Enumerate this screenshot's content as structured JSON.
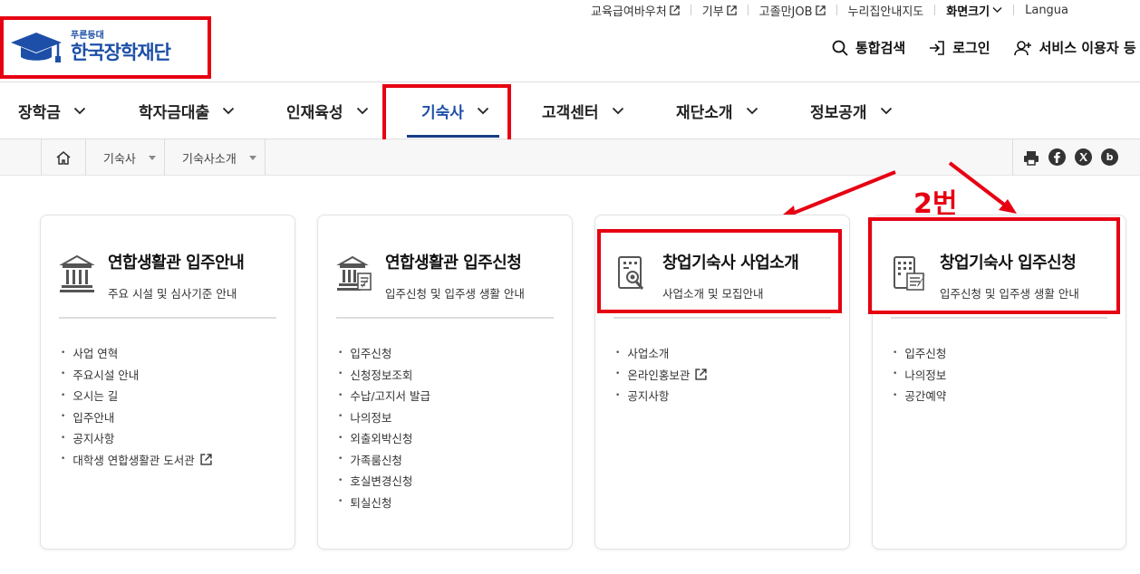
{
  "util_links": [
    {
      "label": "교육급여바우처",
      "external": true
    },
    {
      "label": "기부",
      "external": true
    },
    {
      "label": "고졸만JOB",
      "external": true
    },
    {
      "label": "누리집안내지도",
      "external": false
    },
    {
      "label": "화면크기",
      "dropdown": true
    },
    {
      "label": "Langua"
    }
  ],
  "logo": {
    "small": "푸른등대",
    "main": "한국장학재단"
  },
  "actions": {
    "search": "통합검색",
    "login": "로그인",
    "register": "서비스 이용자 등"
  },
  "nav": [
    {
      "label": "장학금"
    },
    {
      "label": "학자금대출"
    },
    {
      "label": "인재육성"
    },
    {
      "label": "기숙사"
    },
    {
      "label": "고객센터"
    },
    {
      "label": "재단소개"
    },
    {
      "label": "정보공개"
    }
  ],
  "breadcrumb": [
    "기숙사",
    "기숙사소개"
  ],
  "share": [
    "b"
  ],
  "annotation": "2번",
  "cards": [
    {
      "title": "연합생활관 입주안내",
      "subtitle": "주요 시설 및 심사기준 안내",
      "icon": "building-icon",
      "items": [
        "사업 연혁",
        "주요시설 안내",
        "오시는 길",
        "입주안내",
        "공지사항",
        "대학생 연합생활관 도서관"
      ],
      "external_last": true
    },
    {
      "title": "연합생활관 입주신청",
      "subtitle": "입주신청 및 입주생 생활 안내",
      "icon": "building-pen-icon",
      "items": [
        "입주신청",
        "신청정보조회",
        "수납/고지서 발급",
        "나의정보",
        "외출외박신청",
        "가족룸신청",
        "호실변경신청",
        "퇴실신청"
      ]
    },
    {
      "title": "창업기숙사 사업소개",
      "subtitle": "사업소개 및 모집안내",
      "icon": "document-magnifier-icon",
      "items": [
        "사업소개",
        "온라인홍보관",
        "공지사항"
      ],
      "external_index": 1
    },
    {
      "title": "창업기숙사 입주신청",
      "subtitle": "입주신청 및 입주생 생활 안내",
      "icon": "office-pen-icon",
      "items": [
        "입주신청",
        "나의정보",
        "공간예약"
      ]
    }
  ],
  "colors": {
    "brand": "#1d4fa8",
    "accent": "#e60012",
    "underline": "#163c86"
  }
}
